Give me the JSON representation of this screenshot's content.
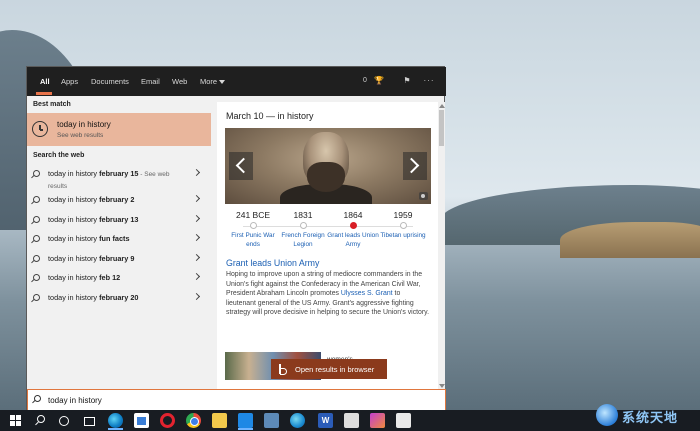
{
  "tabs": [
    {
      "label": "All"
    },
    {
      "label": "Apps"
    },
    {
      "label": "Documents"
    },
    {
      "label": "Email"
    },
    {
      "label": "Web"
    },
    {
      "label": "More"
    }
  ],
  "toolbar": {
    "points": "0"
  },
  "best_match": {
    "heading": "Best match",
    "title": "today in history",
    "subtitle": "See web results"
  },
  "web": {
    "heading": "Search the web",
    "items": [
      {
        "prefix": "today in history ",
        "bold": "february 15",
        "suffix": " - See web results"
      },
      {
        "prefix": "today in history ",
        "bold": "february 2",
        "suffix": ""
      },
      {
        "prefix": "today in history ",
        "bold": "february 13",
        "suffix": ""
      },
      {
        "prefix": "today in history ",
        "bold": "fun facts",
        "suffix": ""
      },
      {
        "prefix": "today in history ",
        "bold": "february 9",
        "suffix": ""
      },
      {
        "prefix": "today in history ",
        "bold": "feb 12",
        "suffix": ""
      },
      {
        "prefix": "today in history ",
        "bold": "february 20",
        "suffix": ""
      }
    ]
  },
  "card": {
    "title": "March 10 — in history",
    "timeline": [
      {
        "year": "241 BCE",
        "label": "First Punic War ends",
        "selected": false
      },
      {
        "year": "1831",
        "label": "French Foreign Legion",
        "selected": false
      },
      {
        "year": "1864",
        "label": "Grant leads Union Army",
        "selected": true
      },
      {
        "year": "1959",
        "label": "Tibetan uprising",
        "selected": false
      }
    ],
    "event_title": "Grant leads Union Army",
    "event_body_1": "Hoping to improve upon a string of mediocre commanders in the Union's fight against the Confederacy in the American Civil War, President Abraham Lincoln promotes ",
    "event_link": "Ulysses S. Grant",
    "event_body_2": " to lieutenant general of the US Army. Grant's aggressive fighting strategy will prove decisive in helping to secure the Union's victory.",
    "news_text": "women's"
  },
  "open_browser": "Open results in browser",
  "search": {
    "value": "today in history"
  },
  "watermark": "系统天地",
  "colors": {
    "accent": "#e0763e",
    "best_match_bg": "#e9b69c",
    "link": "#1b5fb3",
    "selected_dot": "#d81f26"
  }
}
